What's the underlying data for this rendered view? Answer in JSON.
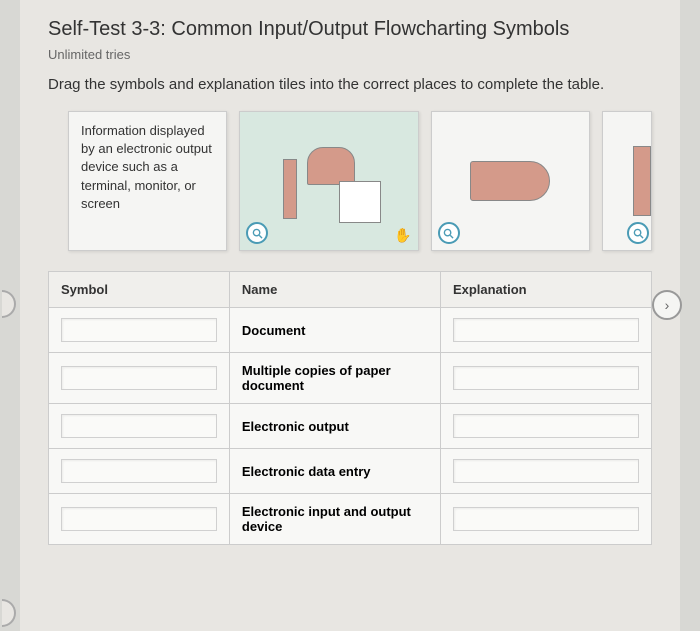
{
  "header": {
    "title": "Self-Test 3-3: Common Input/Output Flowcharting  Symbols",
    "subtitle": "Unlimited tries",
    "instructions": "Drag the symbols and explanation tiles into the correct places to complete the table."
  },
  "tiles": {
    "explanation_tile": "Information displayed by an electronic output device such as a terminal, monitor, or screen"
  },
  "table": {
    "headers": {
      "symbol": "Symbol",
      "name": "Name",
      "explanation": "Explanation"
    },
    "rows": [
      {
        "name": "Document"
      },
      {
        "name": "Multiple copies of paper document"
      },
      {
        "name": "Electronic output"
      },
      {
        "name": "Electronic data entry"
      },
      {
        "name": "Electronic input and output device"
      }
    ]
  }
}
